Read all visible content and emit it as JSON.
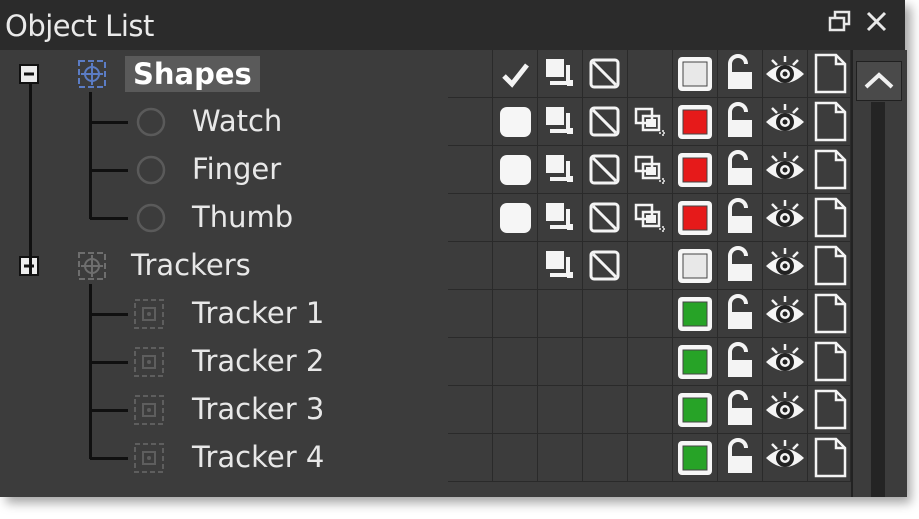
{
  "panel": {
    "title": "Object List"
  },
  "window_controls": [
    {
      "name": "float-window-button",
      "icon": "float-window-icon"
    },
    {
      "name": "close-button",
      "icon": "close-icon"
    }
  ],
  "tree": {
    "groups": [
      {
        "label": "Shapes",
        "expanded": true,
        "selected": true,
        "children": [
          "Watch",
          "Finger",
          "Thumb"
        ]
      },
      {
        "label": "Trackers",
        "expanded": true,
        "selected": false,
        "children": [
          "Tracker 1",
          "Tracker 2",
          "Tracker 3",
          "Tracker 4"
        ]
      }
    ]
  },
  "columns": [
    "visibility-check",
    "layer-order",
    "matte-mode",
    "blend-mode",
    "color",
    "lock",
    "visible",
    "properties"
  ],
  "rows": [
    {
      "check": "checkmark",
      "order": true,
      "matte": true,
      "blend": false,
      "color": "#e8e8e8",
      "lock": true,
      "eye": true,
      "page": true
    },
    {
      "check": "rounded-square",
      "order": true,
      "matte": true,
      "blend": true,
      "color": "#e61a1a",
      "lock": true,
      "eye": true,
      "page": true
    },
    {
      "check": "rounded-square",
      "order": true,
      "matte": true,
      "blend": true,
      "color": "#e61a1a",
      "lock": true,
      "eye": true,
      "page": true
    },
    {
      "check": "rounded-square",
      "order": true,
      "matte": true,
      "blend": true,
      "color": "#e61a1a",
      "lock": true,
      "eye": true,
      "page": true
    },
    {
      "check": "none",
      "order": true,
      "matte": true,
      "blend": false,
      "color": "#e8e8e8",
      "lock": true,
      "eye": true,
      "page": true
    },
    {
      "check": "none",
      "order": false,
      "matte": false,
      "blend": false,
      "color": "#27a327",
      "lock": true,
      "eye": true,
      "page": true
    },
    {
      "check": "none",
      "order": false,
      "matte": false,
      "blend": false,
      "color": "#27a327",
      "lock": true,
      "eye": true,
      "page": true
    },
    {
      "check": "none",
      "order": false,
      "matte": false,
      "blend": false,
      "color": "#27a327",
      "lock": true,
      "eye": true,
      "page": true
    },
    {
      "check": "none",
      "order": false,
      "matte": false,
      "blend": false,
      "color": "#27a327",
      "lock": true,
      "eye": true,
      "page": true
    }
  ],
  "scrollbar": {
    "up_icon": "chevron-up-icon"
  }
}
